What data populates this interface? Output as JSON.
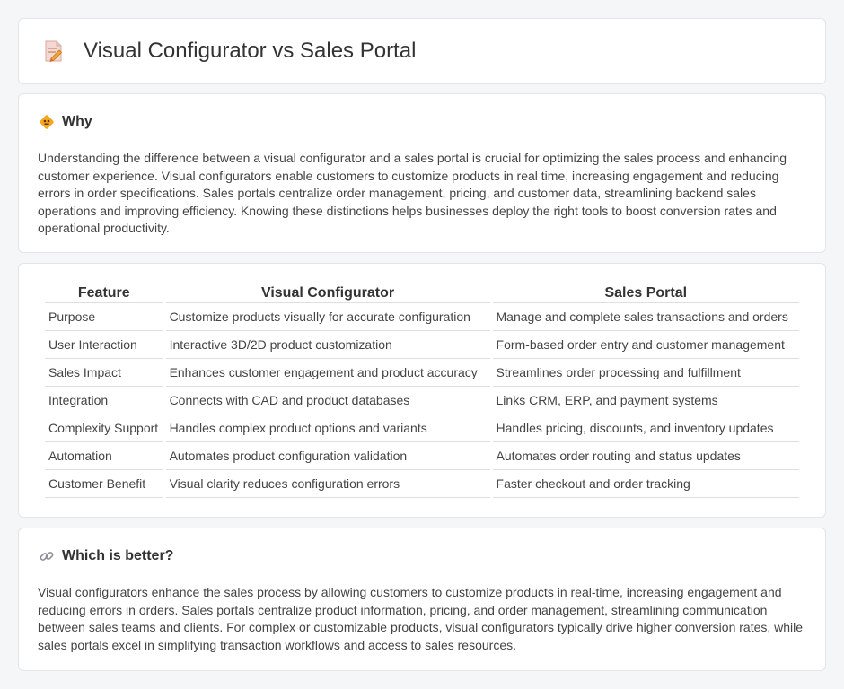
{
  "header": {
    "title": "Visual Configurator vs Sales Portal",
    "icon": "document-pencil-icon"
  },
  "why": {
    "icon": "why-diamond-icon",
    "title": "Why",
    "text": "Understanding the difference between a visual configurator and a sales portal is crucial for optimizing the sales process and enhancing customer experience. Visual configurators enable customers to customize products in real time, increasing engagement and reducing errors in order specifications. Sales portals centralize order management, pricing, and customer data, streamlining backend sales operations and improving efficiency. Knowing these distinctions helps businesses deploy the right tools to boost conversion rates and operational productivity."
  },
  "table": {
    "headers": [
      "Feature",
      "Visual Configurator",
      "Sales Portal"
    ],
    "rows": [
      [
        "Purpose",
        "Customize products visually for accurate configuration",
        "Manage and complete sales transactions and orders"
      ],
      [
        "User Interaction",
        "Interactive 3D/2D product customization",
        "Form-based order entry and customer management"
      ],
      [
        "Sales Impact",
        "Enhances customer engagement and product accuracy",
        "Streamlines order processing and fulfillment"
      ],
      [
        "Integration",
        "Connects with CAD and product databases",
        "Links CRM, ERP, and payment systems"
      ],
      [
        "Complexity Support",
        "Handles complex product options and variants",
        "Handles pricing, discounts, and inventory updates"
      ],
      [
        "Automation",
        "Automates product configuration validation",
        "Automates order routing and status updates"
      ],
      [
        "Customer Benefit",
        "Visual clarity reduces configuration errors",
        "Faster checkout and order tracking"
      ]
    ]
  },
  "better": {
    "icon": "link-icon",
    "title": "Which is better?",
    "text": "Visual configurators enhance the sales process by allowing customers to customize products in real-time, increasing engagement and reducing errors in orders. Sales portals centralize product information, pricing, and order management, streamlining communication between sales teams and clients. For complex or customizable products, visual configurators typically drive higher conversion rates, while sales portals excel in simplifying transaction workflows and access to sales resources."
  }
}
